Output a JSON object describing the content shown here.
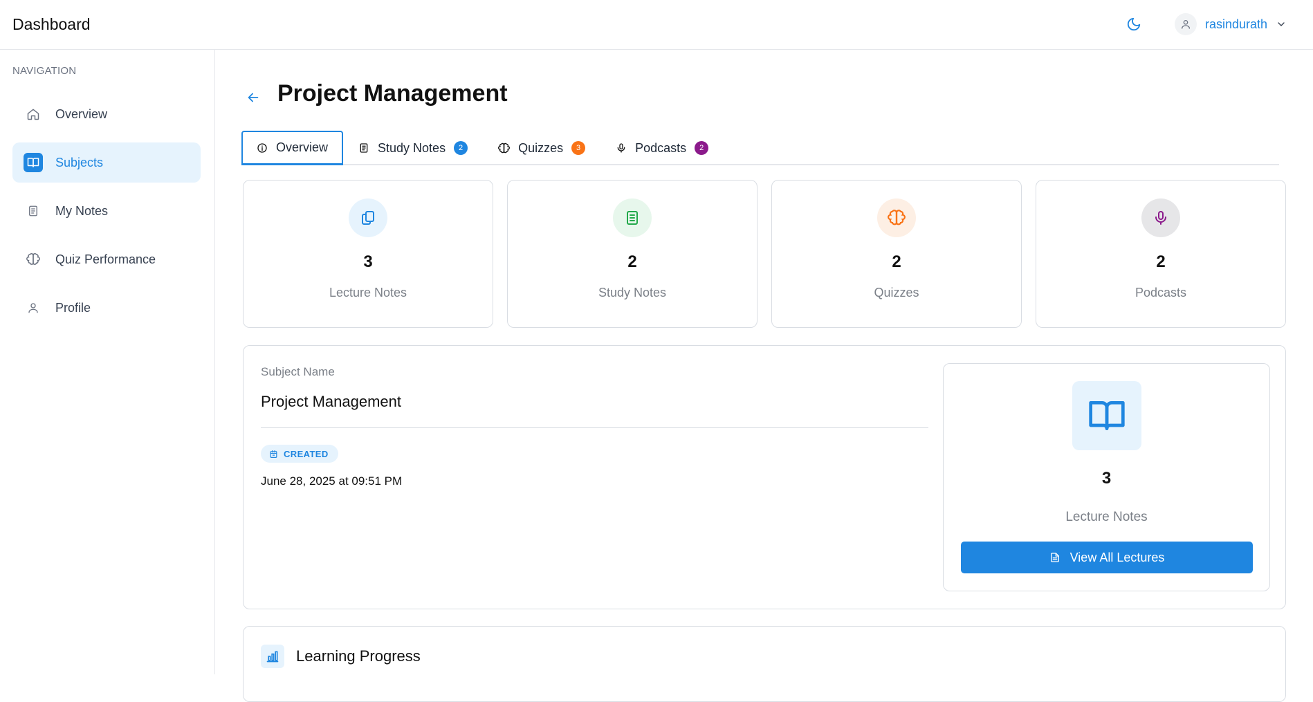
{
  "header": {
    "title": "Dashboard",
    "username": "rasindurath",
    "icons": [
      "moon-icon",
      "user-icon",
      "chevron-down-icon"
    ]
  },
  "sidebar": {
    "heading": "NAVIGATION",
    "items": [
      {
        "label": "Overview",
        "icon": "home-icon",
        "active": false
      },
      {
        "label": "Subjects",
        "icon": "book-open-icon",
        "active": true
      },
      {
        "label": "My Notes",
        "icon": "notes-icon",
        "active": false
      },
      {
        "label": "Quiz Performance",
        "icon": "brain-icon",
        "active": false
      },
      {
        "label": "Profile",
        "icon": "user-icon",
        "active": false
      }
    ]
  },
  "page": {
    "title": "Project Management",
    "tabs": [
      {
        "label": "Overview",
        "icon": "info-icon",
        "active": true
      },
      {
        "label": "Study Notes",
        "icon": "notes-icon",
        "badge": "2",
        "badge_color": "#1f86e0"
      },
      {
        "label": "Quizzes",
        "icon": "brain-icon",
        "badge": "3",
        "badge_color": "#f97316"
      },
      {
        "label": "Podcasts",
        "icon": "mic-icon",
        "badge": "2",
        "badge_color": "#8b1a8b"
      }
    ],
    "stats": [
      {
        "value": "3",
        "label": "Lecture Notes",
        "icon": "copy-icon",
        "color": "#1f86e0",
        "bg": "#e6f3fd"
      },
      {
        "value": "2",
        "label": "Study Notes",
        "icon": "notes-icon",
        "color": "#22a94a",
        "bg": "#e7f7ec"
      },
      {
        "value": "2",
        "label": "Quizzes",
        "icon": "brain-icon",
        "color": "#f97316",
        "bg": "#fdefe4"
      },
      {
        "value": "2",
        "label": "Podcasts",
        "icon": "mic-icon",
        "color": "#8b1a8b",
        "bg": "#e6e6e8"
      }
    ],
    "details": {
      "field_label": "Subject Name",
      "subject_name": "Project Management",
      "created_label": "CREATED",
      "created_date": "June 28, 2025 at 09:51 PM"
    },
    "lectures": {
      "count": "3",
      "label": "Lecture Notes",
      "button": "View All Lectures"
    },
    "progress": {
      "title": "Learning Progress"
    }
  },
  "colors": {
    "accent": "#1f86e0",
    "accent_light": "#e6f3fd",
    "border": "#d9dde3",
    "muted_text": "#7b8088"
  }
}
